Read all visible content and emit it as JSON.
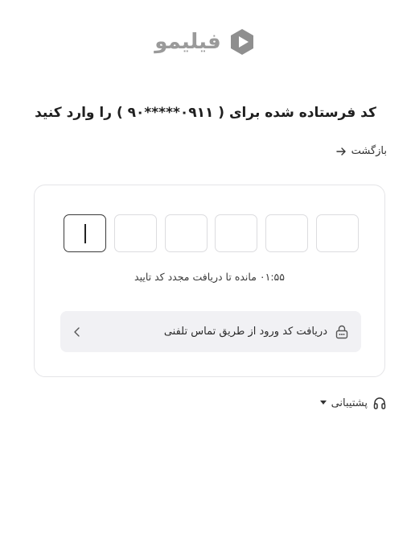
{
  "brand": {
    "name": "فیلیمو",
    "logo_color": "#9a9a9a"
  },
  "page": {
    "title": "کد فرستاده شده برای ( ۰۹۱۱*****۹۰ ) را وارد کنید",
    "back_label": "بازگشت"
  },
  "otp": {
    "length": 6,
    "values": [
      "",
      "",
      "",
      "",
      "",
      ""
    ],
    "active_index": 0
  },
  "timer": {
    "text": "۰۱:۵۵ مانده تا دریافت مجدد کد تایید"
  },
  "call_option": {
    "label": "دریافت کد ورود از طریق تماس تلفنی",
    "icon": "lock-icon"
  },
  "support": {
    "label": "پشتیبانی",
    "icon": "headphones-icon"
  },
  "colors": {
    "border": "#e4e4e7",
    "row_bg": "#f1f1f4",
    "text": "#2b2b2b"
  }
}
